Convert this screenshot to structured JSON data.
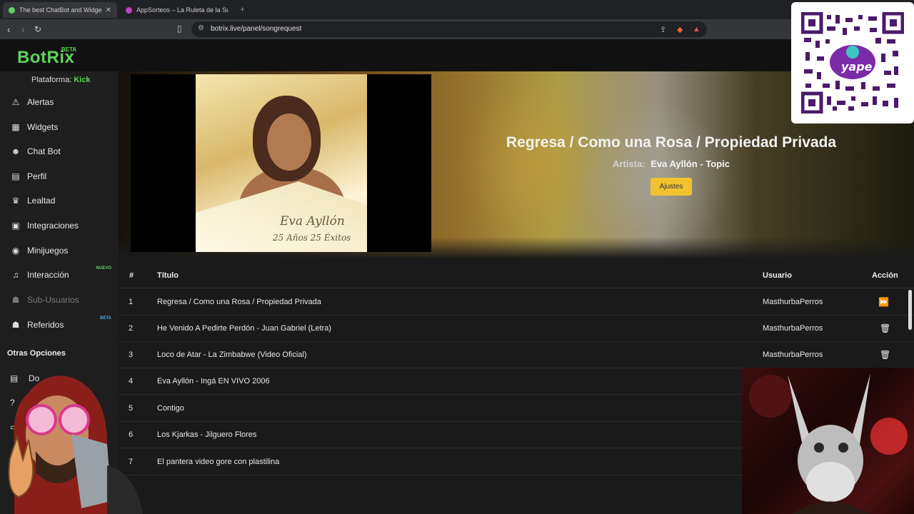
{
  "browser": {
    "tabs": [
      {
        "title": "The best ChatBot and Widge",
        "active": true
      },
      {
        "title": "AppSorteos – La Ruleta de la Suerte",
        "active": false
      }
    ],
    "url": "botrix.live/panel/songrequest"
  },
  "app": {
    "logo": "BotRix",
    "logo_badge": "BETA",
    "platform_label": "Plataforma:",
    "platform_value": "Kick"
  },
  "sidebar": {
    "items": [
      {
        "label": "Alertas",
        "icon": "warning-icon",
        "tag": ""
      },
      {
        "label": "Widgets",
        "icon": "grid-icon",
        "tag": ""
      },
      {
        "label": "Chat Bot",
        "icon": "robot-icon",
        "tag": ""
      },
      {
        "label": "Perfil",
        "icon": "profile-card-icon",
        "tag": ""
      },
      {
        "label": "Lealtad",
        "icon": "trophy-icon",
        "tag": ""
      },
      {
        "label": "Integraciones",
        "icon": "integration-icon",
        "tag": ""
      },
      {
        "label": "Minijuegos",
        "icon": "gamepad-icon",
        "tag": ""
      },
      {
        "label": "Interacción",
        "icon": "music-icon",
        "tag": "NUEVO"
      },
      {
        "label": "Sub-Usuarios",
        "icon": "users-icon",
        "tag": ""
      },
      {
        "label": "Referidos",
        "icon": "referrals-icon",
        "tag": "BETA"
      }
    ],
    "other_heading": "Otras Opciones",
    "other_partial_label": "Do"
  },
  "player": {
    "title": "Regresa / Como una Rosa / Propiedad Privada",
    "artist_label": "Artista:",
    "artist": "Eva Ayllón - Topic",
    "settings_button": "Ajustes",
    "cover_text": "Eva Ayllón",
    "cover_subtext": "25 Años 25 Éxitos"
  },
  "queue": {
    "headers": {
      "num": "#",
      "title": "Título",
      "user": "Usuario",
      "action": "Acción"
    },
    "rows": [
      {
        "num": "1",
        "title": "Regresa / Como una Rosa / Propiedad Privada",
        "user": "MasthurbaPerros",
        "action": "skip"
      },
      {
        "num": "2",
        "title": "He Venido A Pedirte Perdón - Juan Gabriel (Letra)",
        "user": "MasthurbaPerros",
        "action": "delete"
      },
      {
        "num": "3",
        "title": "Loco de Atar - La Zimbabwe (Video Oficial)",
        "user": "MasthurbaPerros",
        "action": "delete"
      },
      {
        "num": "4",
        "title": "Eva Ayllón - Ingá EN VIVO 2006",
        "user": "",
        "action": ""
      },
      {
        "num": "5",
        "title": "Contigo",
        "user": "",
        "action": ""
      },
      {
        "num": "6",
        "title": "Los Kjarkas - Jilguero Flores",
        "user": "",
        "action": ""
      },
      {
        "num": "7",
        "title": "El pantera video gore con plastilina",
        "user": "",
        "action": ""
      }
    ]
  },
  "colors": {
    "accent_green": "#5fd35a",
    "button_yellow": "#f0c230",
    "beta_blue": "#4aa8e0"
  }
}
